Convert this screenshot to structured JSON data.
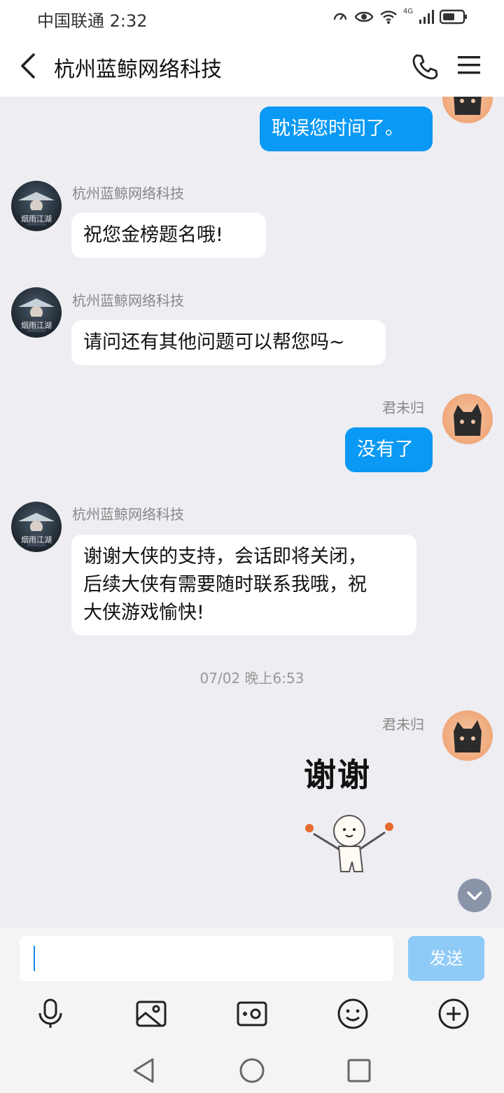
{
  "status_bar": {
    "carrier_time": "中国联通 2:32",
    "network_badge": "4G"
  },
  "header": {
    "title": "杭州蓝鲸网络科技"
  },
  "chat": {
    "messages": [
      {
        "from": "user",
        "text": "耽误您时间了。"
      },
      {
        "from": "agent",
        "sender": "杭州蓝鲸网络科技",
        "text": "祝您金榜题名哦!"
      },
      {
        "from": "agent",
        "sender": "杭州蓝鲸网络科技",
        "text": "请问还有其他问题可以帮您吗~"
      },
      {
        "from": "user",
        "sender": "君未归",
        "text": "没有了"
      },
      {
        "from": "agent",
        "sender": "杭州蓝鲸网络科技",
        "lines": [
          "谢谢大侠的支持，会话即将关闭，",
          "后续大侠有需要随时联系我哦，祝",
          "大侠游戏愉快!"
        ]
      }
    ],
    "timestamp": "07/02 晚上6:53",
    "last": {
      "sender": "君未归",
      "sticker_text": "谢谢"
    },
    "agent_avatar_text": "烟雨江湖"
  },
  "input": {
    "value": "",
    "send_label": "发送"
  },
  "colors": {
    "accent": "#0a99f4",
    "send_disabled": "#8fcbf7",
    "background": "#ededf2"
  }
}
